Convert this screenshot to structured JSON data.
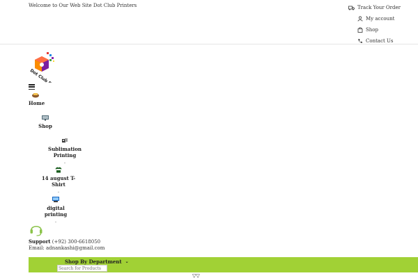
{
  "topbar": {
    "welcome": "Welcome to Our Web Site Dot Club Printers",
    "links": [
      {
        "label": "Track Your Order",
        "icon": "truck-icon"
      },
      {
        "label": "My account",
        "icon": "user-icon"
      },
      {
        "label": "Shop",
        "icon": "bag-icon"
      },
      {
        "label": "Contact Us",
        "icon": "phone-icon"
      }
    ]
  },
  "header": {
    "logo_text": "Dot Club Printers"
  },
  "nav": [
    {
      "label": "Home",
      "icon": "home-image-icon",
      "has_submenu": false
    },
    {
      "label": "Shop",
      "icon": "shop-image-icon",
      "has_submenu": false
    },
    {
      "label": "Sublimation Printing",
      "icon": "sublimation-image-icon",
      "has_submenu": true
    },
    {
      "label": "14 august T-Shirt",
      "icon": "tshirt-image-icon",
      "has_submenu": true
    },
    {
      "label": "digital printing",
      "icon": "digital-printing-image-icon",
      "has_submenu": true
    }
  ],
  "support": {
    "label": "Support",
    "phone": "(+92) 300-6618050",
    "email_label": "Email:",
    "email": "adnankashi@gmail.com"
  },
  "departments": {
    "label": "Shop By Department"
  },
  "search": {
    "placeholder": "Search for Products"
  },
  "colors": {
    "accent": "#a1d135"
  }
}
